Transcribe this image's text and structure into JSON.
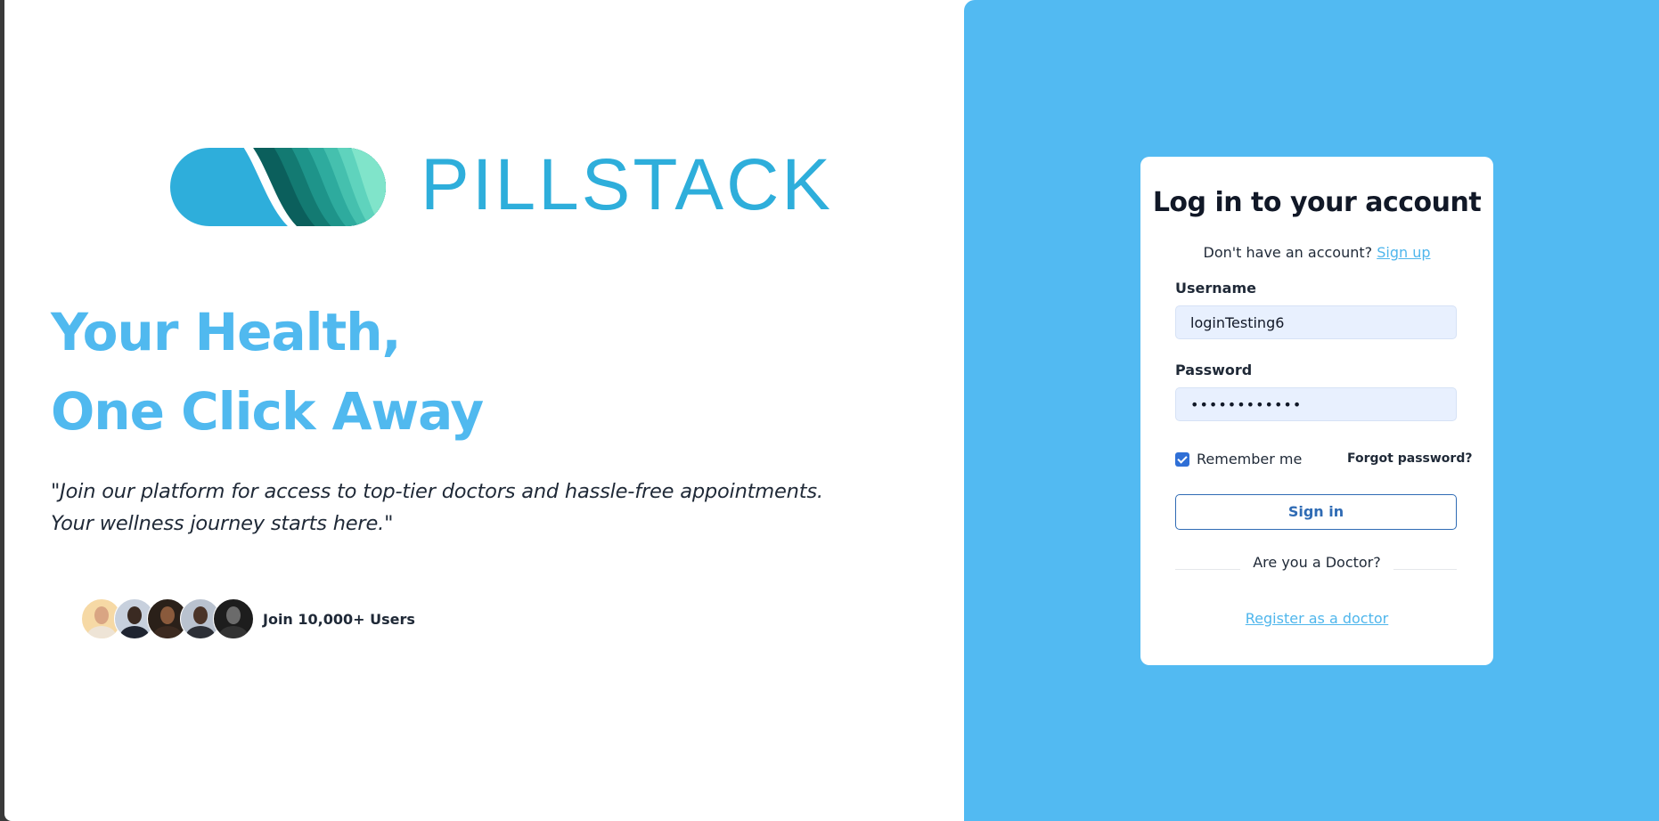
{
  "brand": {
    "name": "PILLSTACK",
    "colors": {
      "primary": "#2eaedb",
      "teal_dark": "#0e6f6a",
      "mint": "#7fe5c8"
    }
  },
  "hero": {
    "headline_line1": "Your Health,",
    "headline_line2": "One Click Away",
    "quote": "\"Join our platform for access to top-tier doctors and hassle-free appointments. Your wellness journey starts here.\"",
    "headline_color": "#50b9ef"
  },
  "social_proof": {
    "label": "Join 10,000+ Users",
    "avatars": [
      {
        "icon": "avatar-user-1"
      },
      {
        "icon": "avatar-user-2"
      },
      {
        "icon": "avatar-user-3"
      },
      {
        "icon": "avatar-user-4"
      },
      {
        "icon": "avatar-user-5"
      }
    ]
  },
  "login": {
    "title": "Log in to your account",
    "signup_prompt": "Don't have an account?",
    "signup_link": "Sign up",
    "username_label": "Username",
    "username_value": "loginTesting6",
    "password_label": "Password",
    "password_value": "••••••••••••",
    "remember_label": "Remember me",
    "remember_checked": true,
    "forgot_label": "Forgot password?",
    "signin_label": "Sign in",
    "doctor_prompt": "Are you a Doctor?",
    "register_doctor_link": "Register as a doctor",
    "panel_color": "#52baf2",
    "button_color": "#2f6bb4"
  }
}
